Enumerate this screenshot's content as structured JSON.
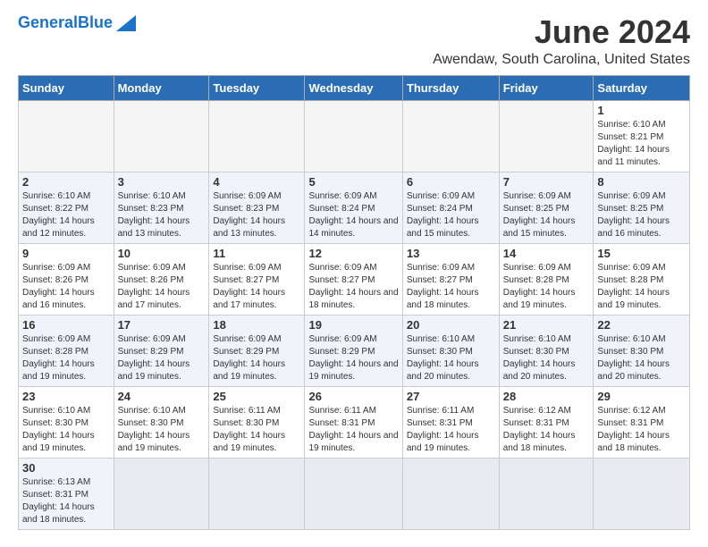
{
  "header": {
    "logo_line1": "General",
    "logo_line2": "Blue",
    "main_title": "June 2024",
    "sub_title": "Awendaw, South Carolina, United States"
  },
  "days_of_week": [
    "Sunday",
    "Monday",
    "Tuesday",
    "Wednesday",
    "Thursday",
    "Friday",
    "Saturday"
  ],
  "weeks": [
    {
      "row_class": "row-odd",
      "days": [
        {
          "date": "",
          "info": "",
          "empty": true
        },
        {
          "date": "",
          "info": "",
          "empty": true
        },
        {
          "date": "",
          "info": "",
          "empty": true
        },
        {
          "date": "",
          "info": "",
          "empty": true
        },
        {
          "date": "",
          "info": "",
          "empty": true
        },
        {
          "date": "",
          "info": "",
          "empty": true
        },
        {
          "date": "1",
          "info": "Sunrise: 6:10 AM\nSunset: 8:21 PM\nDaylight: 14 hours and 11 minutes.",
          "empty": false
        }
      ]
    },
    {
      "row_class": "row-even",
      "days": [
        {
          "date": "2",
          "info": "Sunrise: 6:10 AM\nSunset: 8:22 PM\nDaylight: 14 hours and 12 minutes.",
          "empty": false
        },
        {
          "date": "3",
          "info": "Sunrise: 6:10 AM\nSunset: 8:23 PM\nDaylight: 14 hours and 13 minutes.",
          "empty": false
        },
        {
          "date": "4",
          "info": "Sunrise: 6:09 AM\nSunset: 8:23 PM\nDaylight: 14 hours and 13 minutes.",
          "empty": false
        },
        {
          "date": "5",
          "info": "Sunrise: 6:09 AM\nSunset: 8:24 PM\nDaylight: 14 hours and 14 minutes.",
          "empty": false
        },
        {
          "date": "6",
          "info": "Sunrise: 6:09 AM\nSunset: 8:24 PM\nDaylight: 14 hours and 15 minutes.",
          "empty": false
        },
        {
          "date": "7",
          "info": "Sunrise: 6:09 AM\nSunset: 8:25 PM\nDaylight: 14 hours and 15 minutes.",
          "empty": false
        },
        {
          "date": "8",
          "info": "Sunrise: 6:09 AM\nSunset: 8:25 PM\nDaylight: 14 hours and 16 minutes.",
          "empty": false
        }
      ]
    },
    {
      "row_class": "row-odd",
      "days": [
        {
          "date": "9",
          "info": "Sunrise: 6:09 AM\nSunset: 8:26 PM\nDaylight: 14 hours and 16 minutes.",
          "empty": false
        },
        {
          "date": "10",
          "info": "Sunrise: 6:09 AM\nSunset: 8:26 PM\nDaylight: 14 hours and 17 minutes.",
          "empty": false
        },
        {
          "date": "11",
          "info": "Sunrise: 6:09 AM\nSunset: 8:27 PM\nDaylight: 14 hours and 17 minutes.",
          "empty": false
        },
        {
          "date": "12",
          "info": "Sunrise: 6:09 AM\nSunset: 8:27 PM\nDaylight: 14 hours and 18 minutes.",
          "empty": false
        },
        {
          "date": "13",
          "info": "Sunrise: 6:09 AM\nSunset: 8:27 PM\nDaylight: 14 hours and 18 minutes.",
          "empty": false
        },
        {
          "date": "14",
          "info": "Sunrise: 6:09 AM\nSunset: 8:28 PM\nDaylight: 14 hours and 19 minutes.",
          "empty": false
        },
        {
          "date": "15",
          "info": "Sunrise: 6:09 AM\nSunset: 8:28 PM\nDaylight: 14 hours and 19 minutes.",
          "empty": false
        }
      ]
    },
    {
      "row_class": "row-even",
      "days": [
        {
          "date": "16",
          "info": "Sunrise: 6:09 AM\nSunset: 8:28 PM\nDaylight: 14 hours and 19 minutes.",
          "empty": false
        },
        {
          "date": "17",
          "info": "Sunrise: 6:09 AM\nSunset: 8:29 PM\nDaylight: 14 hours and 19 minutes.",
          "empty": false
        },
        {
          "date": "18",
          "info": "Sunrise: 6:09 AM\nSunset: 8:29 PM\nDaylight: 14 hours and 19 minutes.",
          "empty": false
        },
        {
          "date": "19",
          "info": "Sunrise: 6:09 AM\nSunset: 8:29 PM\nDaylight: 14 hours and 19 minutes.",
          "empty": false
        },
        {
          "date": "20",
          "info": "Sunrise: 6:10 AM\nSunset: 8:30 PM\nDaylight: 14 hours and 20 minutes.",
          "empty": false
        },
        {
          "date": "21",
          "info": "Sunrise: 6:10 AM\nSunset: 8:30 PM\nDaylight: 14 hours and 20 minutes.",
          "empty": false
        },
        {
          "date": "22",
          "info": "Sunrise: 6:10 AM\nSunset: 8:30 PM\nDaylight: 14 hours and 20 minutes.",
          "empty": false
        }
      ]
    },
    {
      "row_class": "row-odd",
      "days": [
        {
          "date": "23",
          "info": "Sunrise: 6:10 AM\nSunset: 8:30 PM\nDaylight: 14 hours and 19 minutes.",
          "empty": false
        },
        {
          "date": "24",
          "info": "Sunrise: 6:10 AM\nSunset: 8:30 PM\nDaylight: 14 hours and 19 minutes.",
          "empty": false
        },
        {
          "date": "25",
          "info": "Sunrise: 6:11 AM\nSunset: 8:30 PM\nDaylight: 14 hours and 19 minutes.",
          "empty": false
        },
        {
          "date": "26",
          "info": "Sunrise: 6:11 AM\nSunset: 8:31 PM\nDaylight: 14 hours and 19 minutes.",
          "empty": false
        },
        {
          "date": "27",
          "info": "Sunrise: 6:11 AM\nSunset: 8:31 PM\nDaylight: 14 hours and 19 minutes.",
          "empty": false
        },
        {
          "date": "28",
          "info": "Sunrise: 6:12 AM\nSunset: 8:31 PM\nDaylight: 14 hours and 18 minutes.",
          "empty": false
        },
        {
          "date": "29",
          "info": "Sunrise: 6:12 AM\nSunset: 8:31 PM\nDaylight: 14 hours and 18 minutes.",
          "empty": false
        }
      ]
    },
    {
      "row_class": "row-even",
      "days": [
        {
          "date": "30",
          "info": "Sunrise: 6:13 AM\nSunset: 8:31 PM\nDaylight: 14 hours and 18 minutes.",
          "empty": false
        },
        {
          "date": "",
          "info": "",
          "empty": true
        },
        {
          "date": "",
          "info": "",
          "empty": true
        },
        {
          "date": "",
          "info": "",
          "empty": true
        },
        {
          "date": "",
          "info": "",
          "empty": true
        },
        {
          "date": "",
          "info": "",
          "empty": true
        },
        {
          "date": "",
          "info": "",
          "empty": true
        }
      ]
    }
  ]
}
